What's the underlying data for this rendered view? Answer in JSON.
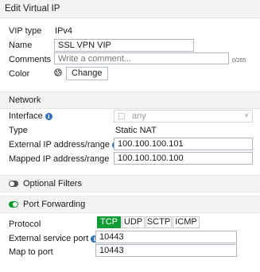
{
  "dialog": {
    "title": "Edit Virtual IP"
  },
  "fields": {
    "vip_type_label": "VIP type",
    "vip_type_value": "IPv4",
    "name_label": "Name",
    "name_value": "SSL VPN VIP",
    "comments_label": "Comments",
    "comments_placeholder": "Write a comment...",
    "comments_counter": "0/255",
    "color_label": "Color",
    "color_button": "Change"
  },
  "network": {
    "section_title": "Network",
    "interface_label": "Interface",
    "interface_value": "any",
    "type_label": "Type",
    "type_value": "Static NAT",
    "external_ip_label": "External IP address/range",
    "external_ip_value": "100.100.100.101",
    "mapped_ip_label": "Mapped IP address/range",
    "mapped_ip_value": "100.100.100.100"
  },
  "optional_filters": {
    "label": "Optional Filters",
    "enabled": false
  },
  "port_forwarding": {
    "label": "Port Forwarding",
    "enabled": true,
    "protocol_label": "Protocol",
    "protocols": [
      "TCP",
      "UDP",
      "SCTP",
      "ICMP"
    ],
    "selected_protocol": "TCP",
    "external_port_label": "External service port",
    "external_port_value": "10443",
    "map_port_label": "Map to port",
    "map_port_value": "10443"
  },
  "colors": {
    "accent_green": "#0d9d34",
    "info_blue": "#2d6eb4",
    "toggle_off": "#555555"
  },
  "icons": {
    "color_swatch": "palette-icon",
    "info": "info-icon",
    "dropdown": "chevron-down-icon"
  }
}
